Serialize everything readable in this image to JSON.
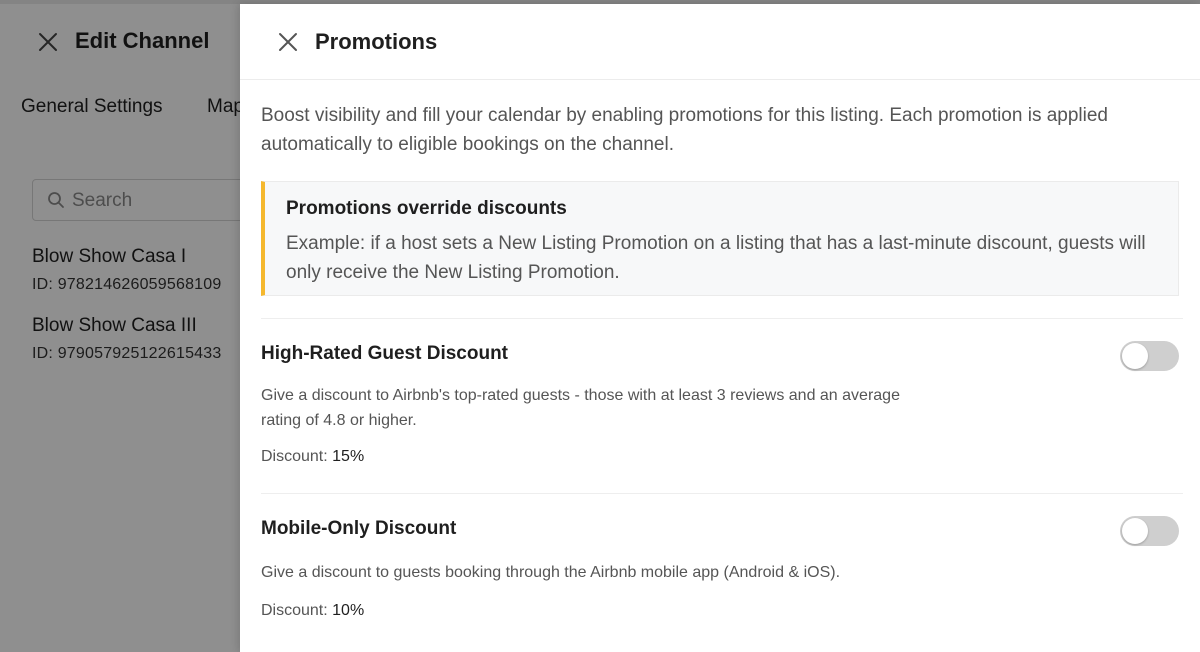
{
  "background_panel": {
    "title": "Edit Channel",
    "tabs": [
      "General Settings",
      "Mapping"
    ],
    "search_placeholder": "Search",
    "listings": [
      {
        "name": "Blow Show Casa I",
        "id_label": "ID:",
        "id": "978214626059568109"
      },
      {
        "name": "Blow Show Casa III",
        "id_label": "ID:",
        "id": "979057925122615433"
      }
    ]
  },
  "drawer": {
    "title": "Promotions",
    "intro": "Boost visibility and fill your calendar by enabling promotions for this listing. Each promotion is applied automatically to eligible bookings on the channel.",
    "notice": {
      "title": "Promotions override discounts",
      "body": "Example: if a host sets a New Listing Promotion on a listing that has a last-minute discount, guests will only receive the New Listing Promotion."
    },
    "promotions": [
      {
        "title": "High-Rated Guest Discount",
        "description": "Give a discount to Airbnb's top-rated guests - those with at least 3 reviews and an average rating of 4.8 or higher.",
        "discount_label": "Discount:",
        "discount_value": "15%",
        "enabled": false
      },
      {
        "title": "Mobile-Only Discount",
        "description": "Give a discount to guests booking through the Airbnb mobile app (Android & iOS).",
        "discount_label": "Discount:",
        "discount_value": "10%",
        "enabled": false
      }
    ]
  },
  "colors": {
    "notice_accent": "#f5b82e",
    "toggle_off": "#cfcfcf"
  },
  "icons": {
    "close": "close-icon",
    "search": "search-icon"
  }
}
